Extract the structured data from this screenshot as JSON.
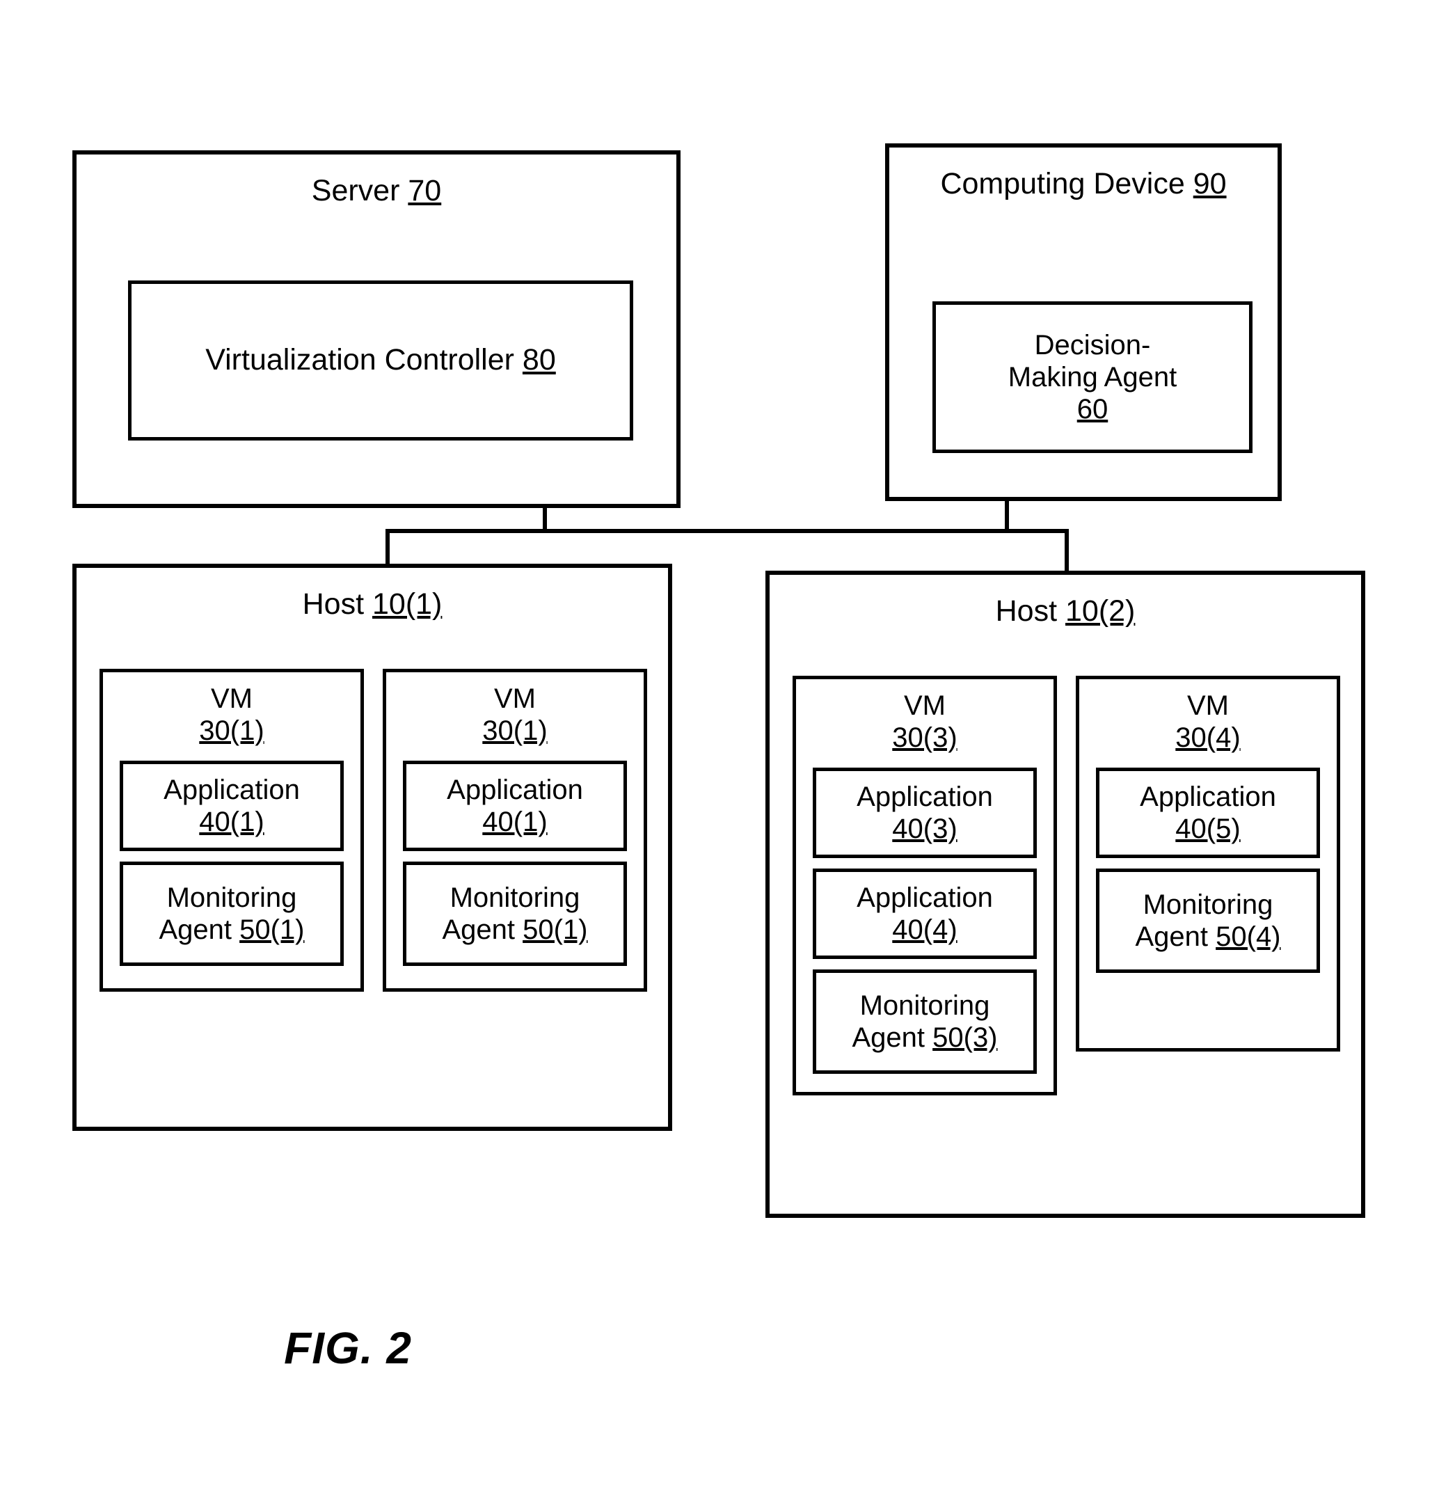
{
  "figure": {
    "caption": "FIG. 2"
  },
  "server": {
    "title_text": "Server ",
    "title_ref": "70",
    "controller": {
      "text": "Virtualization Controller ",
      "ref": "80"
    }
  },
  "computing_device": {
    "title_text": "Computing Device ",
    "title_ref": "90",
    "agent": {
      "line1": "Decision-",
      "line2": "Making Agent",
      "ref": "60"
    }
  },
  "hosts": [
    {
      "title_text": "Host ",
      "title_ref": "10(1)",
      "vms": [
        {
          "name": "VM",
          "ref": "30(1)",
          "components": [
            {
              "line1": "Application",
              "line2": "",
              "ref": "40(1)",
              "ref_on_line": 2
            },
            {
              "line1": "Monitoring",
              "line2": "Agent ",
              "ref": "50(1)",
              "ref_on_line": 2
            }
          ]
        },
        {
          "name": "VM",
          "ref": "30(1)",
          "components": [
            {
              "line1": "Application",
              "line2": "",
              "ref": "40(1)",
              "ref_on_line": 2
            },
            {
              "line1": "Monitoring",
              "line2": "Agent ",
              "ref": "50(1)",
              "ref_on_line": 2
            }
          ]
        }
      ]
    },
    {
      "title_text": "Host ",
      "title_ref": "10(2)",
      "vms": [
        {
          "name": "VM",
          "ref": "30(3)",
          "components": [
            {
              "line1": "Application",
              "line2": "",
              "ref": "40(3)",
              "ref_on_line": 2
            },
            {
              "line1": "Application",
              "line2": "",
              "ref": "40(4)",
              "ref_on_line": 2
            },
            {
              "line1": "Monitoring",
              "line2": "Agent ",
              "ref": "50(3)",
              "ref_on_line": 2
            }
          ]
        },
        {
          "name": "VM",
          "ref": "30(4)",
          "components": [
            {
              "line1": "Application",
              "line2": "",
              "ref": "40(5)",
              "ref_on_line": 2
            },
            {
              "line1": "Monitoring",
              "line2": "Agent ",
              "ref": "50(4)",
              "ref_on_line": 2
            }
          ]
        }
      ]
    }
  ],
  "colors": {
    "stroke": "#000000",
    "background": "#ffffff"
  }
}
